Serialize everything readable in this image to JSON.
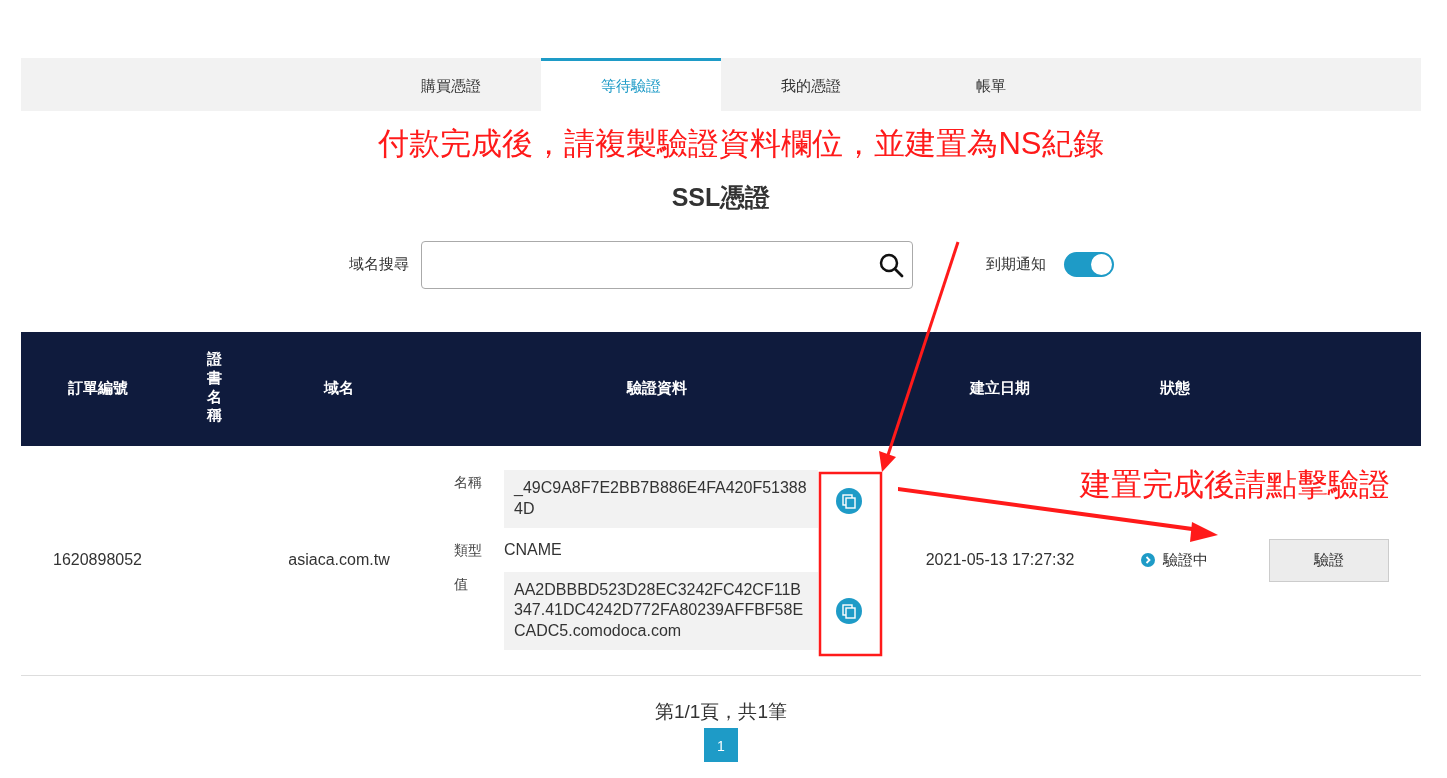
{
  "tabs": [
    {
      "label": "購買憑證",
      "selected": false
    },
    {
      "label": "等待驗證",
      "selected": true
    },
    {
      "label": "我的憑證",
      "selected": false
    },
    {
      "label": "帳單",
      "selected": false
    }
  ],
  "annotations": [
    "付款完成後，請複製驗證資料欄位，並建置為NS紀錄",
    "建置完成後請點擊驗證"
  ],
  "title": "SSL憑證",
  "search": {
    "label": "域名搜尋"
  },
  "notify": {
    "label": "到期通知",
    "on": true
  },
  "table": {
    "columns": [
      "訂單編號",
      "證書名稱",
      "域名",
      "驗證資料",
      "建立日期",
      "狀態"
    ],
    "rows": [
      {
        "order": "1620898052",
        "domain": "asiaca.com.tw",
        "verification": {
          "name_label": "名稱",
          "name": "_49C9A8F7E2BB7B886E4FA420F513884D",
          "type_label": "類型",
          "type": "CNAME",
          "value_label": "值",
          "value": "AA2DBBBD523D28EC3242FC42CF11B347.41DC4242D772FA80239AFFBF58ECADC5.comodoca.com"
        },
        "created": "2021-05-13 17:27:32",
        "status": "驗證中",
        "action": "驗證"
      }
    ]
  },
  "pagination": {
    "summary": "第1/1頁，共1筆",
    "pages": [
      {
        "label": "1",
        "selected": true
      }
    ]
  }
}
